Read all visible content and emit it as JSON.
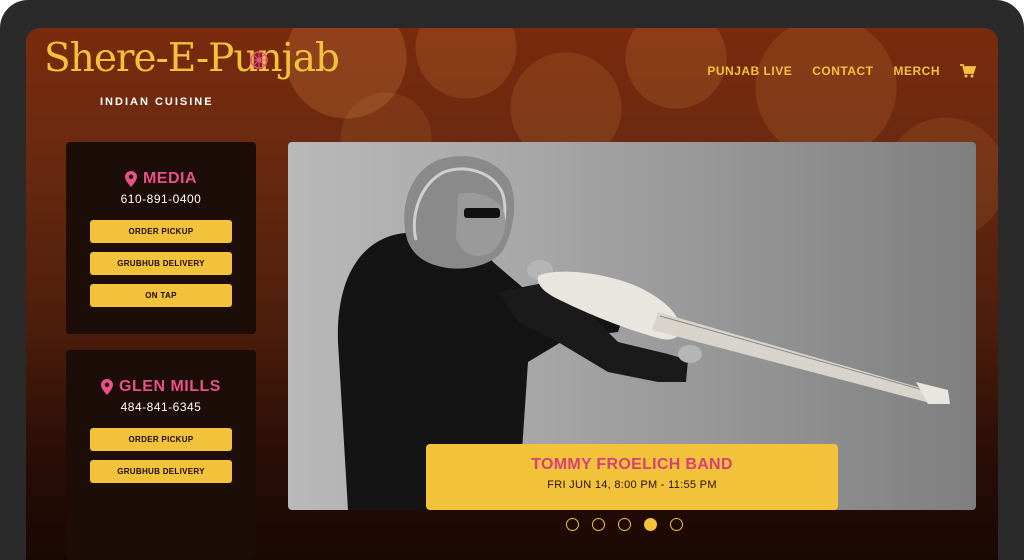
{
  "brand": {
    "title": "Shere-E-Punjab",
    "subtitle": "INDIAN CUISINE"
  },
  "nav": {
    "items": [
      "PUNJAB LIVE",
      "CONTACT",
      "MERCH"
    ],
    "cart_icon": "shopping-cart-icon"
  },
  "locations": [
    {
      "name": "MEDIA",
      "phone": "610-891-0400",
      "buttons": [
        "ORDER PICKUP",
        "GRUBHUB DELIVERY",
        "ON TAP"
      ]
    },
    {
      "name": "GLEN MILLS",
      "phone": "484-841-6345",
      "buttons": [
        "ORDER PICKUP",
        "GRUBHUB DELIVERY"
      ]
    }
  ],
  "hero": {
    "event_title": "TOMMY FROELICH BAND",
    "event_date": "FRI JUN 14, 8:00 PM - 11:55 PM"
  },
  "carousel": {
    "count": 5,
    "active_index": 3
  },
  "colors": {
    "accent_yellow": "#f2c23a",
    "accent_pink": "#e8508a",
    "card_bg": "#1c0d08"
  }
}
